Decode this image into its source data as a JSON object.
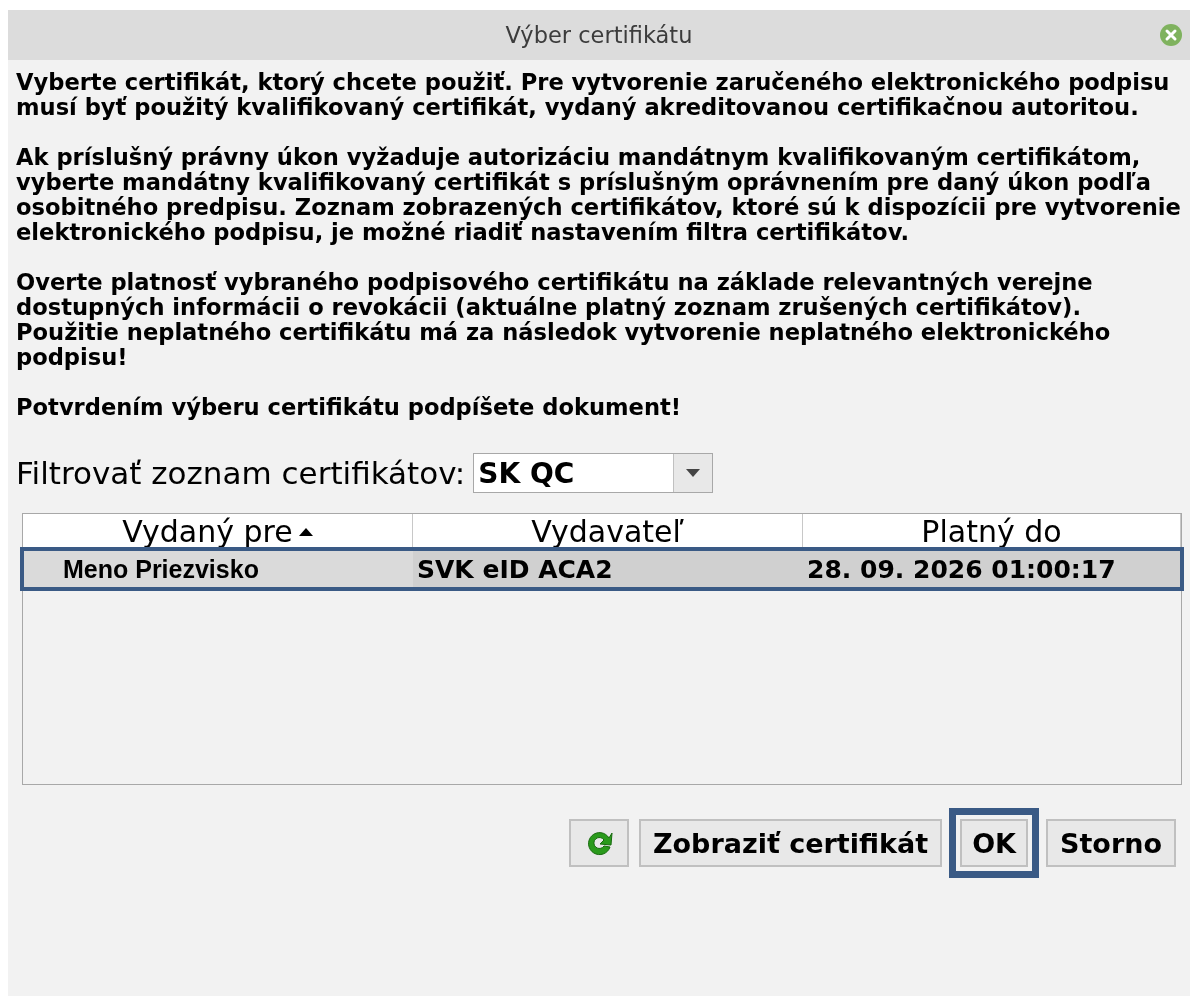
{
  "window": {
    "title": "Výber certifikátu"
  },
  "paragraphs": [
    "Vyberte certifikát, ktorý chcete použiť. Pre vytvorenie zaručeného elektronického podpisu musí byť použitý kvalifikovaný certifikát, vydaný akreditovanou certifikačnou autoritou.",
    "Ak príslušný právny úkon vyžaduje autorizáciu mandátnym kvalifikovaným certifikátom, vyberte mandátny kvalifikovaný certifikát s príslušným oprávnením pre daný úkon podľa osobitného predpisu. Zoznam zobrazených certifikátov, ktoré sú k dispozícii pre vytvorenie elektronického podpisu, je možné riadiť nastavením filtra certifikátov.",
    "Overte platnosť vybraného podpisového certifikátu na základe relevantných verejne dostupných informácii o revokácii (aktuálne platný zoznam zrušených certifikátov). Použitie neplatného certifikátu má za následok vytvorenie neplatného elektronického podpisu!",
    "Potvrdením výberu certifikátu podpíšete dokument!"
  ],
  "filter": {
    "label": "Filtrovať zoznam certifikátov:",
    "value": "SK QC"
  },
  "table": {
    "columns": [
      {
        "label": "Vydaný pre",
        "sorted": true
      },
      {
        "label": "Vydavateľ",
        "sorted": false
      },
      {
        "label": "Platný do",
        "sorted": false
      }
    ],
    "rows": [
      {
        "cells": [
          "Meno Priezvisko",
          "SVK eID ACA2",
          "28. 09. 2026 01:00:17"
        ],
        "selected": true,
        "highlighted": true
      }
    ]
  },
  "buttons": [
    {
      "kind": "refresh",
      "highlighted": false
    },
    {
      "kind": "text",
      "label": "Zobraziť certifikát",
      "highlighted": false
    },
    {
      "kind": "text",
      "label": "OK",
      "highlighted": true
    },
    {
      "kind": "text",
      "label": "Storno",
      "highlighted": false
    }
  ]
}
